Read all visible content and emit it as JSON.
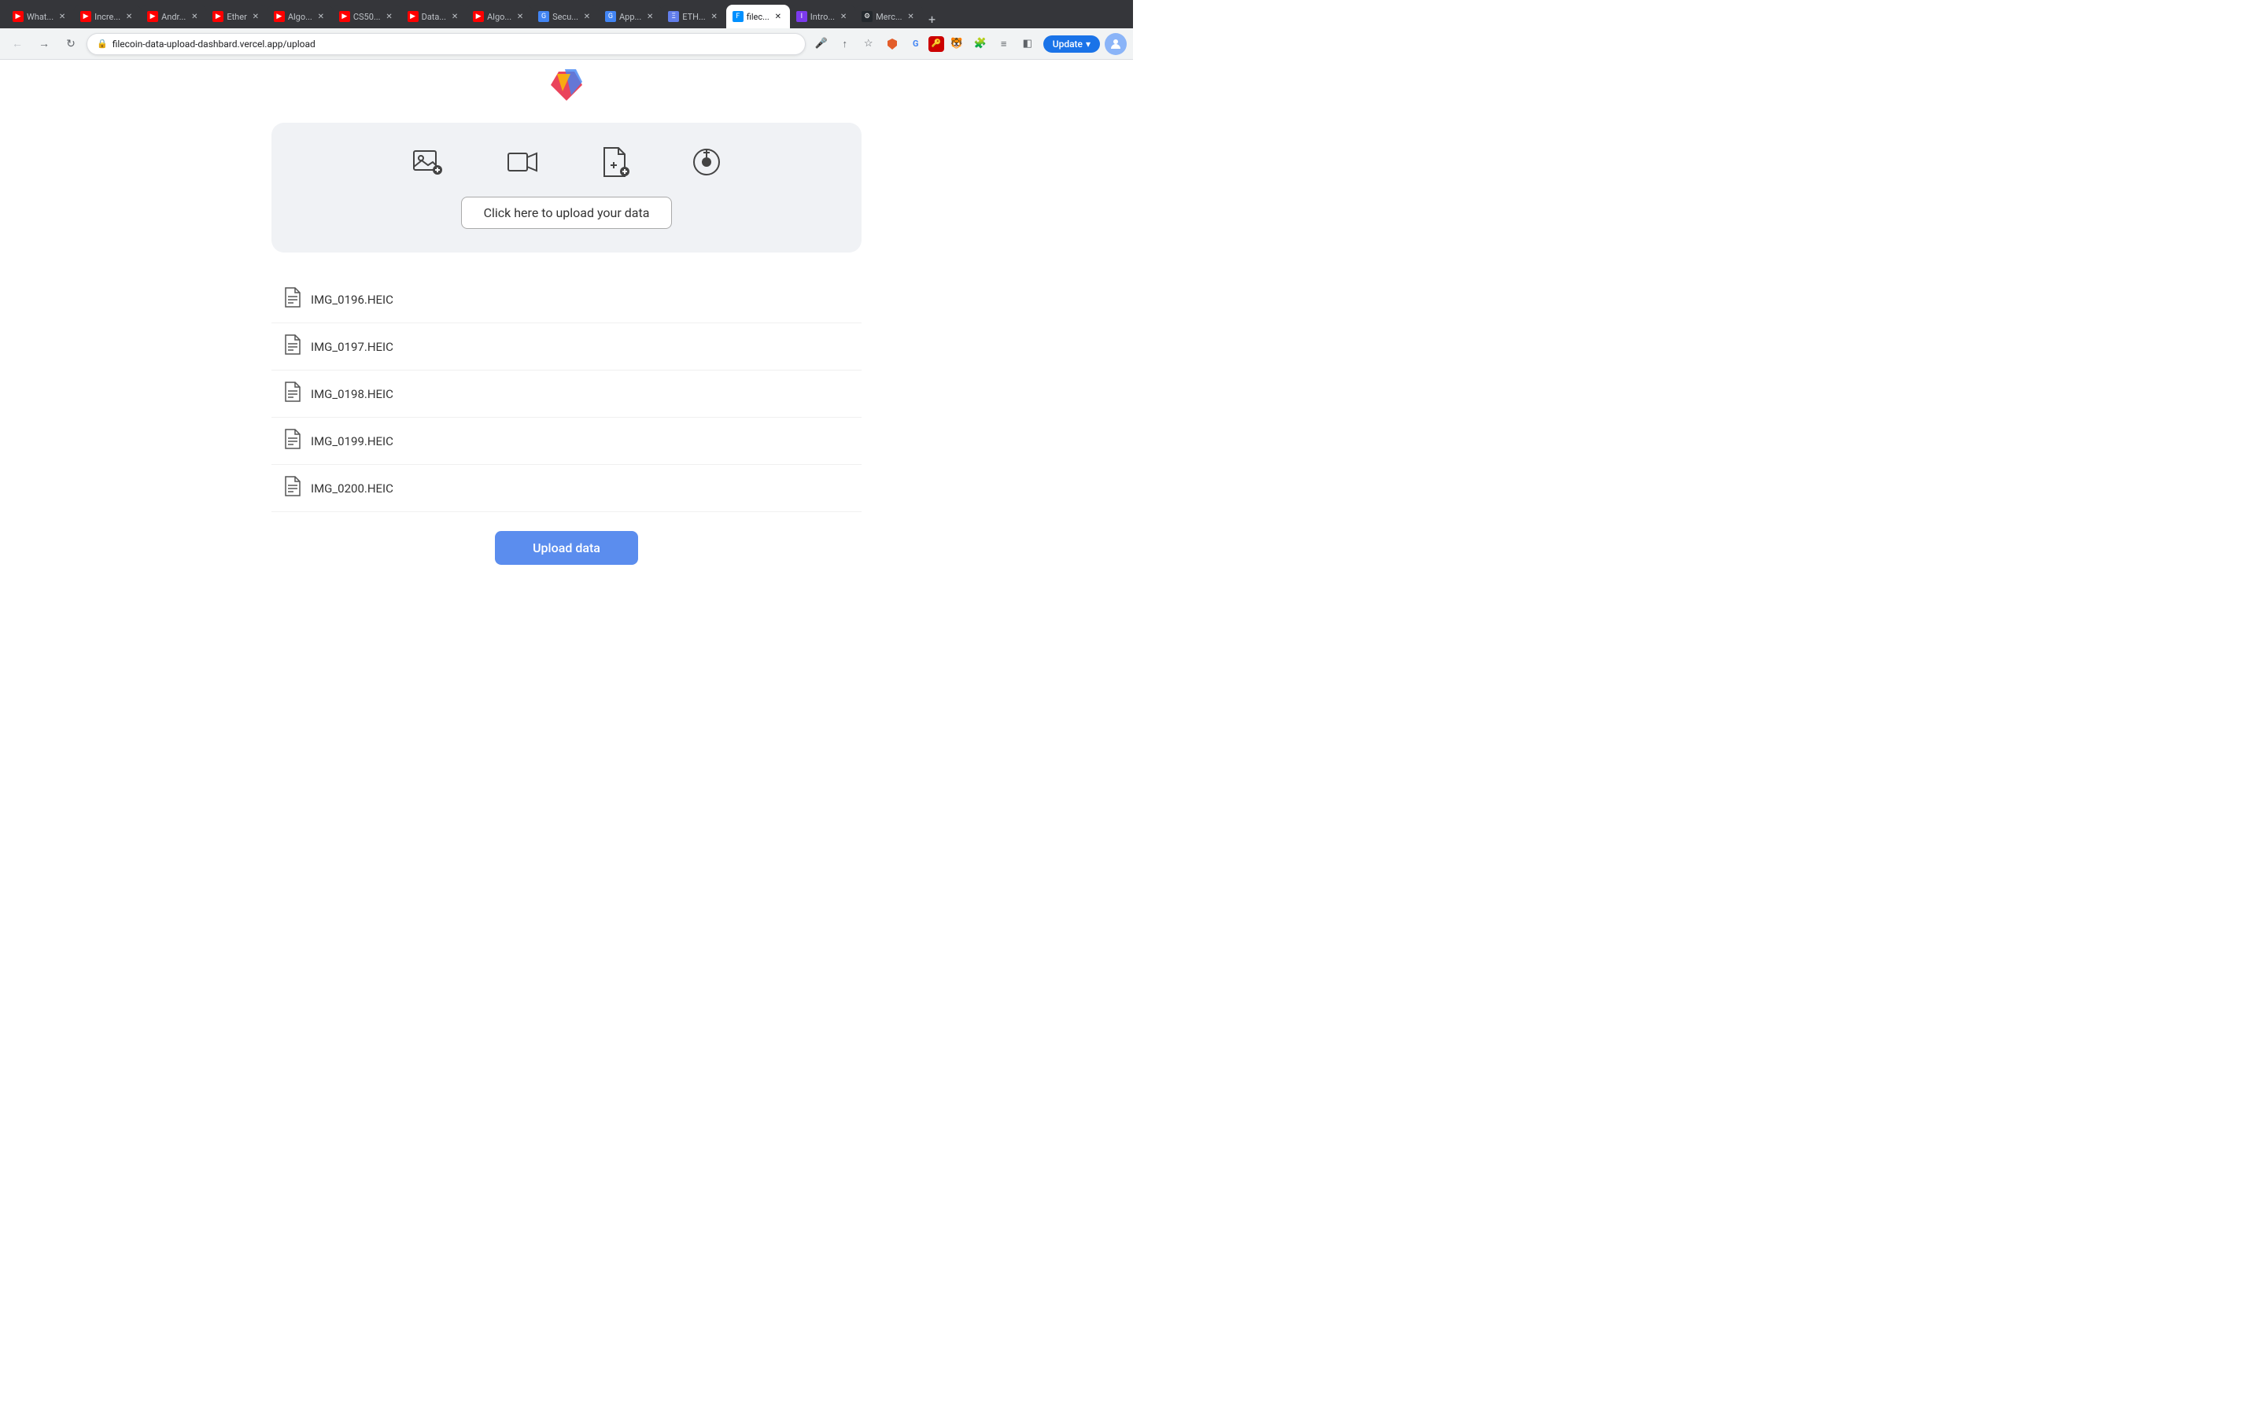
{
  "browser": {
    "tabs": [
      {
        "id": "tab1",
        "label": "What...",
        "favicon_type": "yt",
        "active": false
      },
      {
        "id": "tab2",
        "label": "Incre...",
        "favicon_type": "yt",
        "active": false
      },
      {
        "id": "tab3",
        "label": "Andr...",
        "favicon_type": "yt",
        "active": false
      },
      {
        "id": "tab4",
        "label": "Ether",
        "favicon_type": "yt",
        "active": false
      },
      {
        "id": "tab5",
        "label": "Algo...",
        "favicon_type": "yt",
        "active": false
      },
      {
        "id": "tab6",
        "label": "CS50...",
        "favicon_type": "yt",
        "active": false
      },
      {
        "id": "tab7",
        "label": "Data...",
        "favicon_type": "yt",
        "active": false
      },
      {
        "id": "tab8",
        "label": "Algo...",
        "favicon_type": "yt",
        "active": false
      },
      {
        "id": "tab9",
        "label": "Secu...",
        "favicon_type": "google",
        "active": false
      },
      {
        "id": "tab10",
        "label": "App...",
        "favicon_type": "google",
        "active": false
      },
      {
        "id": "tab11",
        "label": "ETH...",
        "favicon_type": "eth",
        "active": false
      },
      {
        "id": "tab12",
        "label": "filec...",
        "favicon_type": "filecoin",
        "active": true
      },
      {
        "id": "tab13",
        "label": "Intro...",
        "favicon_type": "intro",
        "active": false
      },
      {
        "id": "tab14",
        "label": "Merc...",
        "favicon_type": "github",
        "active": false
      }
    ],
    "url": "filecoin-data-upload-dashbard.vercel.app/upload",
    "update_label": "Update"
  },
  "page": {
    "upload_box": {
      "icons": [
        {
          "name": "image-icon",
          "symbol": "🖼"
        },
        {
          "name": "video-icon",
          "symbol": "📹"
        },
        {
          "name": "document-add-icon",
          "symbol": "📋"
        },
        {
          "name": "music-icon",
          "symbol": "🎵"
        }
      ],
      "upload_button_label": "Click here to upload your data"
    },
    "files": [
      {
        "name": "IMG_0196.HEIC"
      },
      {
        "name": "IMG_0197.HEIC"
      },
      {
        "name": "IMG_0198.HEIC"
      },
      {
        "name": "IMG_0199.HEIC"
      },
      {
        "name": "IMG_0200.HEIC"
      }
    ],
    "submit_button_label": "Upload data"
  }
}
